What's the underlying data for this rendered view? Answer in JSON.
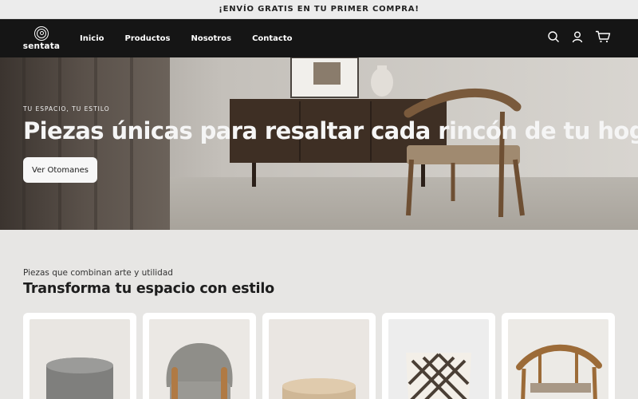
{
  "announcement": "¡ENVÍO GRATIS EN TU PRIMER COMPRA!",
  "header": {
    "logo_text": "sentata",
    "menu": [
      "Inicio",
      "Productos",
      "Nosotros",
      "Contacto"
    ],
    "icons": [
      "search-icon",
      "user-icon",
      "cart-icon"
    ]
  },
  "hero": {
    "kicker": "TU ESPACIO, TU ESTILO",
    "title": "Piezas únicas para resaltar cada rincón de tu hogar",
    "button_label": "Ver Otomanes"
  },
  "collection": {
    "subtitle": "Piezas que combinan arte y utilidad",
    "title": "Transforma tu espacio con estilo",
    "products": [
      "gray-ottoman",
      "gray-armchair",
      "beige-ottoman",
      "patterned-cushion",
      "wooden-chair"
    ]
  },
  "colors": {
    "nav_bg": "#151515",
    "announcement_bg": "#ececec",
    "page_bg": "#e7e6e4",
    "button_bg": "#f7f7f7"
  }
}
